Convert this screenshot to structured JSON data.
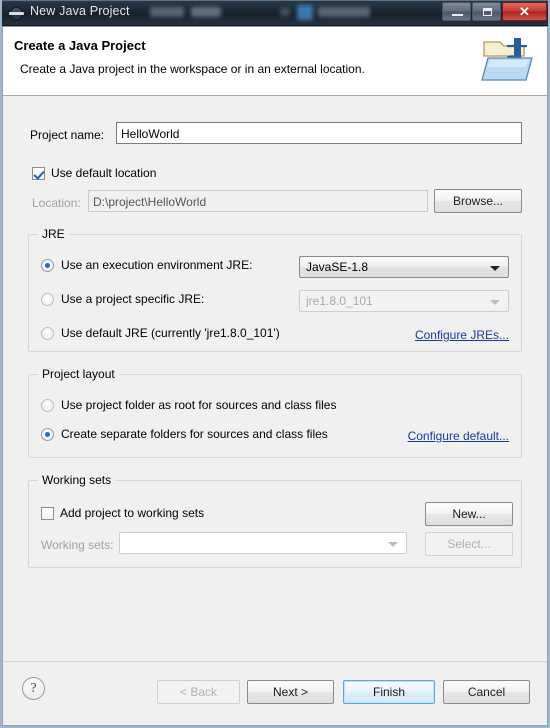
{
  "window": {
    "title": "New Java Project",
    "icon": "eclipse-globe-icon",
    "minimize_label": "",
    "maximize_label": "",
    "close_label": "✕"
  },
  "header": {
    "title": "Create a Java Project",
    "subtitle": "Create a Java project in the workspace or in an external location.",
    "icon": "java-project-folder-icon"
  },
  "project": {
    "name_label": "Project name:",
    "name_value": "HelloWorld",
    "use_default_location_label": "Use default location",
    "use_default_location_checked": true,
    "location_label": "Location:",
    "location_value": "D:\\project\\HelloWorld",
    "browse_label": "Browse..."
  },
  "jre": {
    "group_title": "JRE",
    "option_execution_env_label": "Use an execution environment JRE:",
    "option_execution_env_selected": true,
    "execution_env_value": "JavaSE-1.8",
    "option_project_specific_label": "Use a project specific JRE:",
    "option_project_specific_selected": false,
    "project_specific_value": "jre1.8.0_101",
    "option_default_jre_label": "Use default JRE (currently 'jre1.8.0_101')",
    "option_default_jre_selected": false,
    "configure_jres_link": "Configure JREs..."
  },
  "project_layout": {
    "group_title": "Project layout",
    "option_root_label": "Use project folder as root for sources and class files",
    "option_root_selected": false,
    "option_separate_label": "Create separate folders for sources and class files",
    "option_separate_selected": true,
    "configure_default_link": "Configure default..."
  },
  "working_sets": {
    "group_title": "Working sets",
    "add_project_label": "Add project to working sets",
    "add_project_checked": false,
    "new_label": "New...",
    "working_sets_label": "Working sets:",
    "working_sets_value": "",
    "select_label": "Select..."
  },
  "footer": {
    "help_label": "?",
    "back_label": "< Back",
    "back_enabled": false,
    "next_label": "Next >",
    "next_enabled": true,
    "finish_label": "Finish",
    "finish_is_default": true,
    "cancel_label": "Cancel"
  },
  "colors": {
    "accent_link": "#18399c",
    "radio_dot": "#1c6fc9",
    "checkbox_check": "#1a5fb4",
    "default_button_border": "#5ba8d8",
    "titlebar_dark": "#1b2733",
    "close_red": "#c63a30",
    "dialog_bg": "#f0f0f0"
  }
}
